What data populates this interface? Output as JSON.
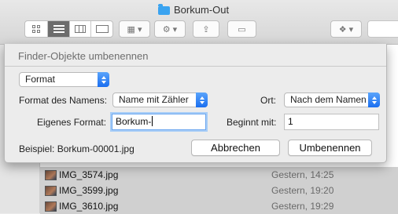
{
  "window": {
    "title": "Borkum-Out",
    "folder_icon": "folder-icon",
    "toolbar": {
      "view_buttons": [
        {
          "name": "icon-view",
          "icon": "grid-icon"
        },
        {
          "name": "list-view",
          "icon": "list-icon",
          "active": true
        },
        {
          "name": "column-view",
          "icon": "columns-icon"
        },
        {
          "name": "cover-flow-view",
          "icon": "cover-flow-icon"
        }
      ],
      "arrange_icon": "arrange-icon",
      "action_icon": "gear-icon",
      "share_icon": "share-icon",
      "tags_icon": "tag-icon",
      "dropbox_icon": "dropbox-icon"
    }
  },
  "dialog": {
    "title": "Finder-Objekte umbenennen",
    "mode_popup": "Format",
    "name_format_label": "Format des Namens:",
    "name_format_value": "Name mit Zähler",
    "location_label": "Ort:",
    "location_value": "Nach dem Namen",
    "custom_format_label": "Eigenes Format:",
    "custom_format_value": "Borkum-",
    "start_at_label": "Beginnt mit:",
    "start_at_value": "1",
    "example_text": "Beispiel: Borkum-00001.jpg",
    "cancel_label": "Abbrechen",
    "rename_label": "Umbenennen"
  },
  "files": [
    {
      "name": "IMG_3574.jpg",
      "date": "Gestern, 14:25"
    },
    {
      "name": "IMG_3599.jpg",
      "date": "Gestern, 19:20"
    },
    {
      "name": "IMG_3610.jpg",
      "date": "Gestern, 19:29"
    }
  ]
}
